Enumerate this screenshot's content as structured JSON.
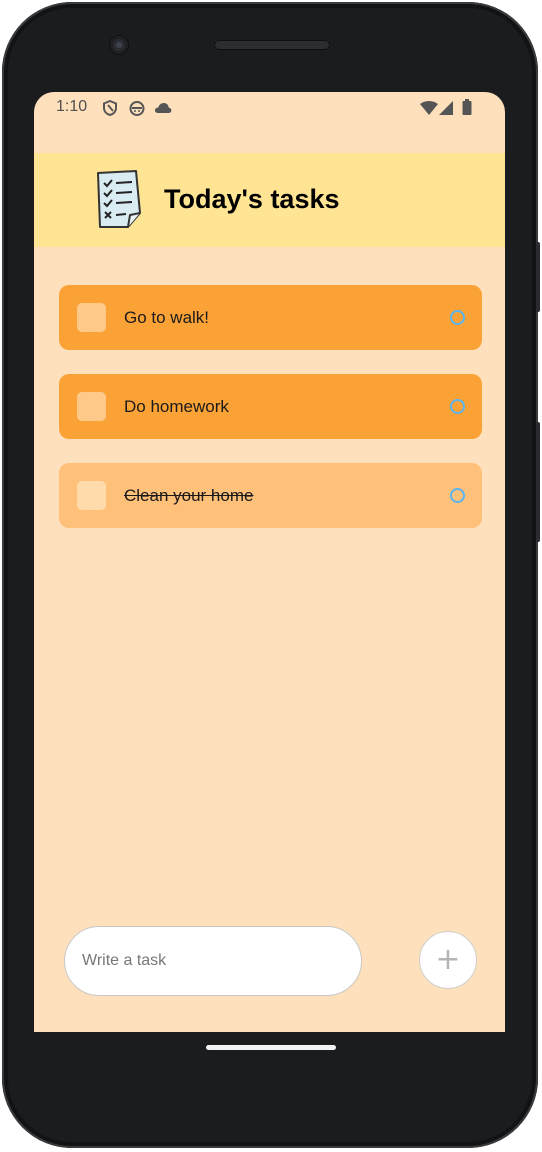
{
  "status_bar": {
    "time": "1:10",
    "left_icons": [
      "shield-icon",
      "android-icon",
      "cloud-icon"
    ],
    "right_icons": [
      "wifi-icon",
      "signal-icon",
      "battery-icon"
    ]
  },
  "header": {
    "title": "Today's tasks",
    "icon": "checklist-notepad-icon"
  },
  "tasks": [
    {
      "label": "Go to walk!",
      "completed": false
    },
    {
      "label": "Do homework",
      "completed": false
    },
    {
      "label": "Clean your home",
      "completed": true
    }
  ],
  "composer": {
    "placeholder": "Write a task",
    "add_button_label": "+"
  },
  "colors": {
    "background": "#ffe0bd",
    "header": "#ffe493",
    "task_active": "#fba237",
    "task_done": "#ffc07a",
    "circle": "#5ab4f0"
  }
}
